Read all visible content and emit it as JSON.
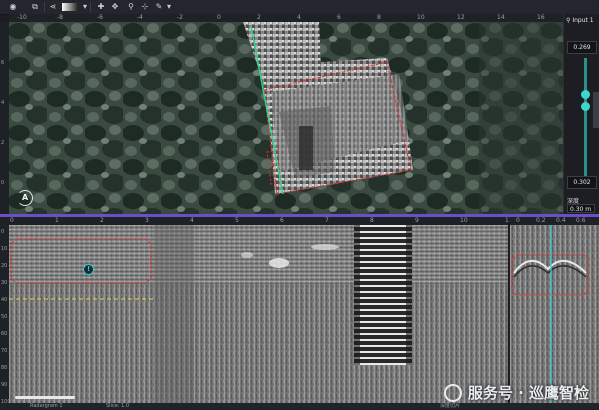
{
  "toolbar": {
    "icons": [
      "eye-icon",
      "layers-icon",
      "share-icon",
      "gradient-icon",
      "cursor-icon",
      "tools-icon",
      "marker-icon",
      "settings-icon",
      "pen-icon"
    ]
  },
  "map": {
    "ruler_x_labels": [
      "-10",
      "-8",
      "-6",
      "-4",
      "-2",
      "0",
      "2",
      "4",
      "6",
      "8",
      "10",
      "12",
      "14",
      "16",
      "18"
    ],
    "ruler_y_labels": [
      "6",
      "4",
      "2",
      "0",
      "-2"
    ],
    "compass_label": "A"
  },
  "right_panel": {
    "input_label": "Input 1",
    "top_value": "0.269",
    "bottom_value": "0.302",
    "depth_label": "深度",
    "depth_value": "0.30 m"
  },
  "radargram": {
    "ruler_x_labels": [
      "0",
      "1",
      "2",
      "3",
      "4",
      "5",
      "6",
      "7",
      "8",
      "9",
      "10",
      "11"
    ],
    "ruler_y_labels": [
      "0",
      "10",
      "20",
      "30",
      "40",
      "50",
      "60",
      "70",
      "80",
      "90",
      "100"
    ],
    "marker_label": "!"
  },
  "side_view": {
    "ruler_x_labels": [
      "0",
      "0.2",
      "0.4",
      "0.6"
    ]
  },
  "statusbar": {
    "left_text": "Radargram 1",
    "mid_text": "Slice: 1.0",
    "right_text": "深度切片"
  },
  "watermark": {
    "text": "服务号 · 巡鹰智检"
  },
  "colors": {
    "accent": "#6b4fc8",
    "annotation_red": "#e03030",
    "annotation_yellow": "#e8d84a",
    "track_green": "#2fd18a",
    "track_cyan": "#35c9d4"
  }
}
